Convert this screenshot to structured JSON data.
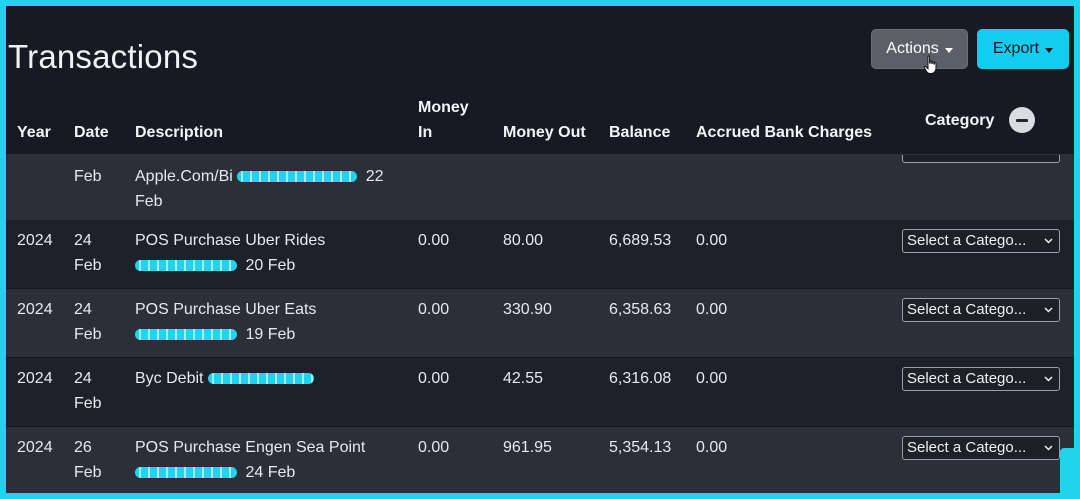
{
  "header": {
    "title": "Transactions",
    "actions_label": "Actions",
    "export_label": "Export"
  },
  "table": {
    "columns": {
      "year": "Year",
      "date": "Date",
      "description": "Description",
      "money_in": "Money In",
      "money_out": "Money Out",
      "balance": "Balance",
      "accrued": "Accrued Bank Charges",
      "category": "Category"
    },
    "partial_row": {
      "date": "Feb",
      "description": "Apple.Com/Bi",
      "description_suffix": "22 Feb"
    },
    "rows": [
      {
        "year": "2024",
        "date": "24 Feb",
        "description": "POS Purchase Uber Rides",
        "description_suffix": "20 Feb",
        "money_in": "0.00",
        "money_out": "80.00",
        "balance": "6,689.53",
        "accrued": "0.00",
        "category": "Select a Catego..."
      },
      {
        "year": "2024",
        "date": "24 Feb",
        "description": "POS Purchase Uber Eats",
        "description_suffix": "19 Feb",
        "money_in": "0.00",
        "money_out": "330.90",
        "balance": "6,358.63",
        "accrued": "0.00",
        "category": "Select a Catego..."
      },
      {
        "year": "2024",
        "date": "24 Feb",
        "description": "Byc Debit",
        "description_suffix": "",
        "money_in": "0.00",
        "money_out": "42.55",
        "balance": "6,316.08",
        "accrued": "0.00",
        "category": "Select a Catego..."
      },
      {
        "year": "2024",
        "date": "26 Feb",
        "description": "POS Purchase Engen Sea Point",
        "description_suffix": "24 Feb",
        "money_in": "0.00",
        "money_out": "961.95",
        "balance": "5,354.13",
        "accrued": "0.00",
        "category": "Select a Catego..."
      }
    ]
  },
  "icons": {
    "actions_caret": "caret-down-icon",
    "export_caret": "caret-down-icon",
    "category_toggle": "minus-circle-icon",
    "select_chevron": "chevron-down-icon",
    "cursor": "hand-pointer-icon"
  },
  "colors": {
    "accent": "#22d3ee",
    "background": "#171a22",
    "row_odd": "#2b2f37",
    "row_even": "#1e2129",
    "actions_button": "#5b6068"
  }
}
